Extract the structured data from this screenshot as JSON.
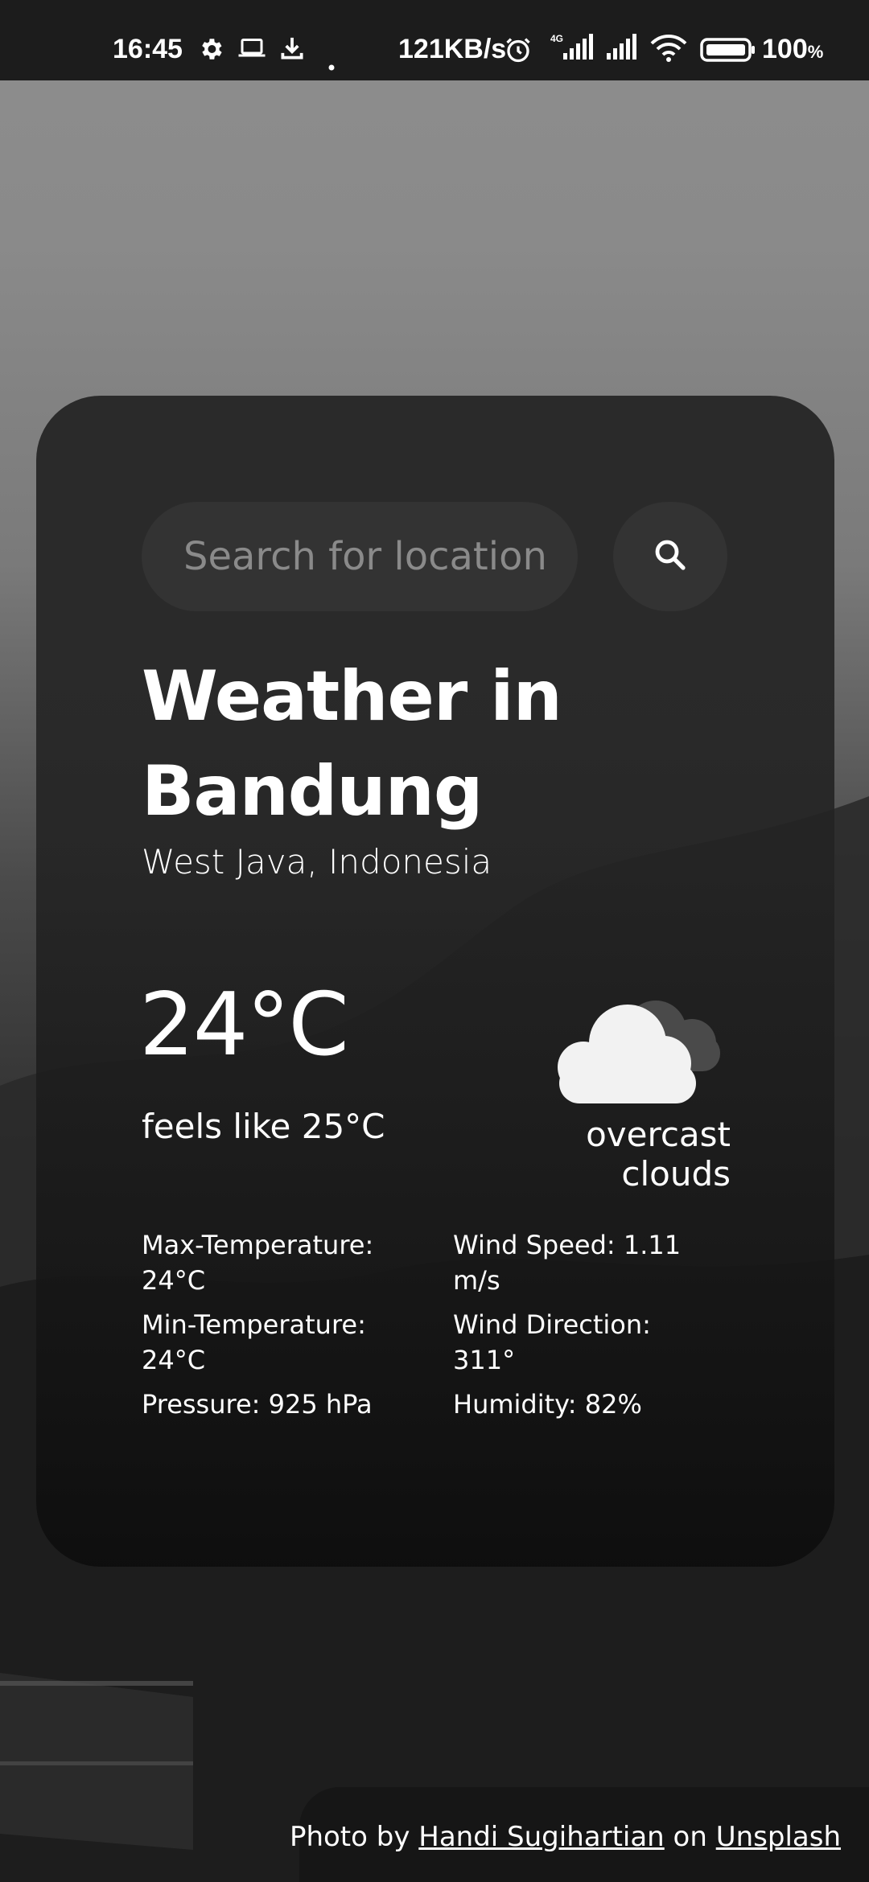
{
  "status_bar": {
    "time": "16:45",
    "network_speed": "121KB/s",
    "battery_percent": "100",
    "battery_unit": "%",
    "network_type": "4G"
  },
  "search": {
    "placeholder": "Search for location"
  },
  "weather": {
    "title": "Weather in Bandung",
    "region": "West Java, Indonesia",
    "temperature": "24°C",
    "feels_like": "feels like 25°C",
    "description": "overcast clouds",
    "icon": "overcast-clouds-icon"
  },
  "details": {
    "max_temp": "Max-Temperature: 24°C",
    "min_temp": "Min-Temperature: 24°C",
    "pressure": "Pressure: 925 hPa",
    "wind_speed": "Wind Speed: 1.11 m/s",
    "wind_direction": "Wind Direction: 311°",
    "humidity": "Humidity: 82%"
  },
  "credit": {
    "prefix": "Photo by",
    "author": "Handi Sugihartian",
    "middle": "on",
    "source": "Unsplash"
  }
}
